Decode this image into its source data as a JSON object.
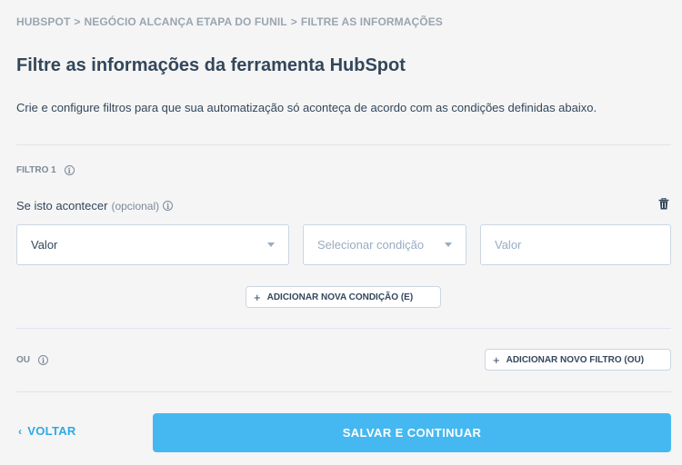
{
  "breadcrumb": {
    "items": [
      "HUBSPOT",
      "NEGÓCIO ALCANÇA ETAPA DO FUNIL",
      "FILTRE AS INFORMAÇÕES"
    ],
    "separator": ">"
  },
  "header": {
    "title": "Filtre as informações da ferramenta HubSpot",
    "description": "Crie e configure filtros para que sua automatização só aconteça de acordo com as condições definidas abaixo."
  },
  "filter": {
    "label": "FILTRO 1",
    "condition_label": "Se isto acontecer",
    "condition_optional": "(opcional)",
    "field_select": "Valor",
    "condition_select_placeholder": "Selecionar condição",
    "value_placeholder": "Valor",
    "add_condition_label": "ADICIONAR NOVA CONDIÇÃO (E)"
  },
  "or_section": {
    "label": "OU",
    "add_filter_label": "ADICIONAR NOVO FILTRO (OU)"
  },
  "footer": {
    "back_label": "VOLTAR",
    "save_label": "SALVAR E CONTINUAR"
  },
  "icons": {
    "info": "info-icon",
    "trash": "trash-icon",
    "plus": "plus-icon",
    "chevron_left": "chevron-left-icon",
    "caret": "caret-down-icon"
  },
  "colors": {
    "accent": "#45b8f1",
    "link": "#2fa9e6",
    "text": "#33475b",
    "muted": "#7c8a99",
    "background": "#f5f5f5"
  }
}
